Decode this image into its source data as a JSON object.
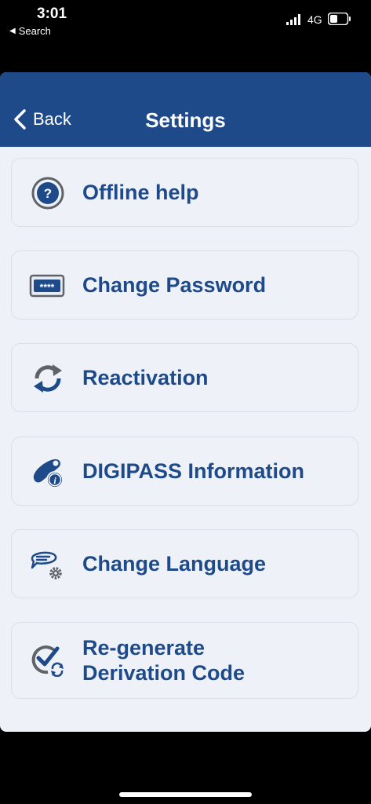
{
  "status_bar": {
    "time": "3:01",
    "back_app": "Search",
    "network": "4G"
  },
  "nav": {
    "back_label": "Back",
    "title": "Settings"
  },
  "menu": {
    "items": [
      {
        "label": "Offline help",
        "icon": "question-circle-icon"
      },
      {
        "label": "Change Password",
        "icon": "password-field-icon"
      },
      {
        "label": "Reactivation",
        "icon": "refresh-arrows-icon"
      },
      {
        "label": "DIGIPASS Information",
        "icon": "digipass-info-icon"
      },
      {
        "label": "Change Language",
        "icon": "language-gear-icon"
      },
      {
        "label": "Re-generate\nDerivation Code",
        "icon": "check-refresh-icon"
      }
    ]
  },
  "colors": {
    "brand": "#1e4a8a",
    "background": "#eef2f8",
    "icon_gray": "#5f6368"
  }
}
